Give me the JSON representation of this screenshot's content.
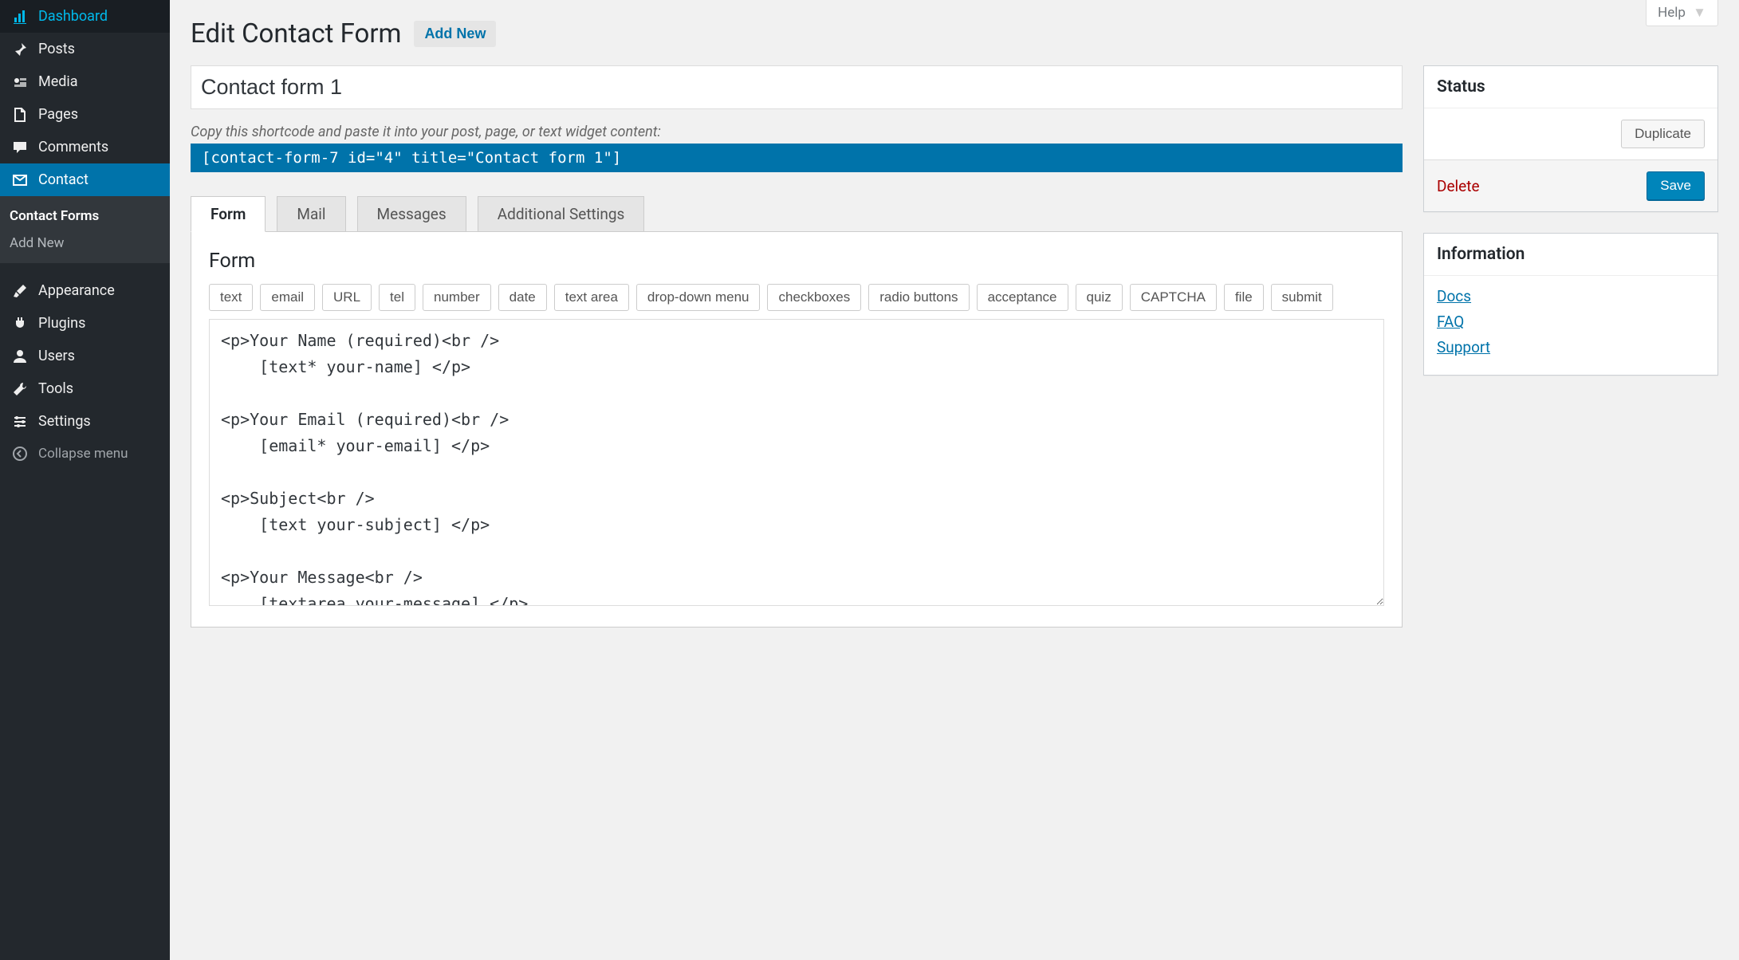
{
  "help_label": "Help",
  "sidebar": {
    "items": [
      {
        "icon": "dashboard",
        "label": "Dashboard"
      },
      {
        "icon": "pin",
        "label": "Posts"
      },
      {
        "icon": "media",
        "label": "Media"
      },
      {
        "icon": "page",
        "label": "Pages"
      },
      {
        "icon": "comment",
        "label": "Comments"
      },
      {
        "icon": "mail",
        "label": "Contact"
      }
    ],
    "submenu": [
      {
        "label": "Contact Forms",
        "current": true
      },
      {
        "label": "Add New"
      }
    ],
    "items2": [
      {
        "icon": "brush",
        "label": "Appearance"
      },
      {
        "icon": "plug",
        "label": "Plugins"
      },
      {
        "icon": "user",
        "label": "Users"
      },
      {
        "icon": "wrench",
        "label": "Tools"
      },
      {
        "icon": "sliders",
        "label": "Settings"
      }
    ],
    "collapse_label": "Collapse menu"
  },
  "page": {
    "title": "Edit Contact Form",
    "add_new": "Add New",
    "form_title": "Contact form 1",
    "shortcode_hint": "Copy this shortcode and paste it into your post, page, or text widget content:",
    "shortcode": "[contact-form-7 id=\"4\" title=\"Contact form 1\"]"
  },
  "tabs": [
    "Form",
    "Mail",
    "Messages",
    "Additional Settings"
  ],
  "form_panel": {
    "title": "Form",
    "tag_buttons": [
      "text",
      "email",
      "URL",
      "tel",
      "number",
      "date",
      "text area",
      "drop-down menu",
      "checkboxes",
      "radio buttons",
      "acceptance",
      "quiz",
      "CAPTCHA",
      "file",
      "submit"
    ],
    "content": "<p>Your Name (required)<br />\n    [text* your-name] </p>\n\n<p>Your Email (required)<br />\n    [email* your-email] </p>\n\n<p>Subject<br />\n    [text your-subject] </p>\n\n<p>Your Message<br />\n    [textarea your-message] </p>\n\n<p>[submit \"Send\"]</p>"
  },
  "status": {
    "title": "Status",
    "duplicate": "Duplicate",
    "delete": "Delete",
    "save": "Save"
  },
  "info": {
    "title": "Information",
    "links": [
      "Docs",
      "FAQ",
      "Support"
    ]
  }
}
